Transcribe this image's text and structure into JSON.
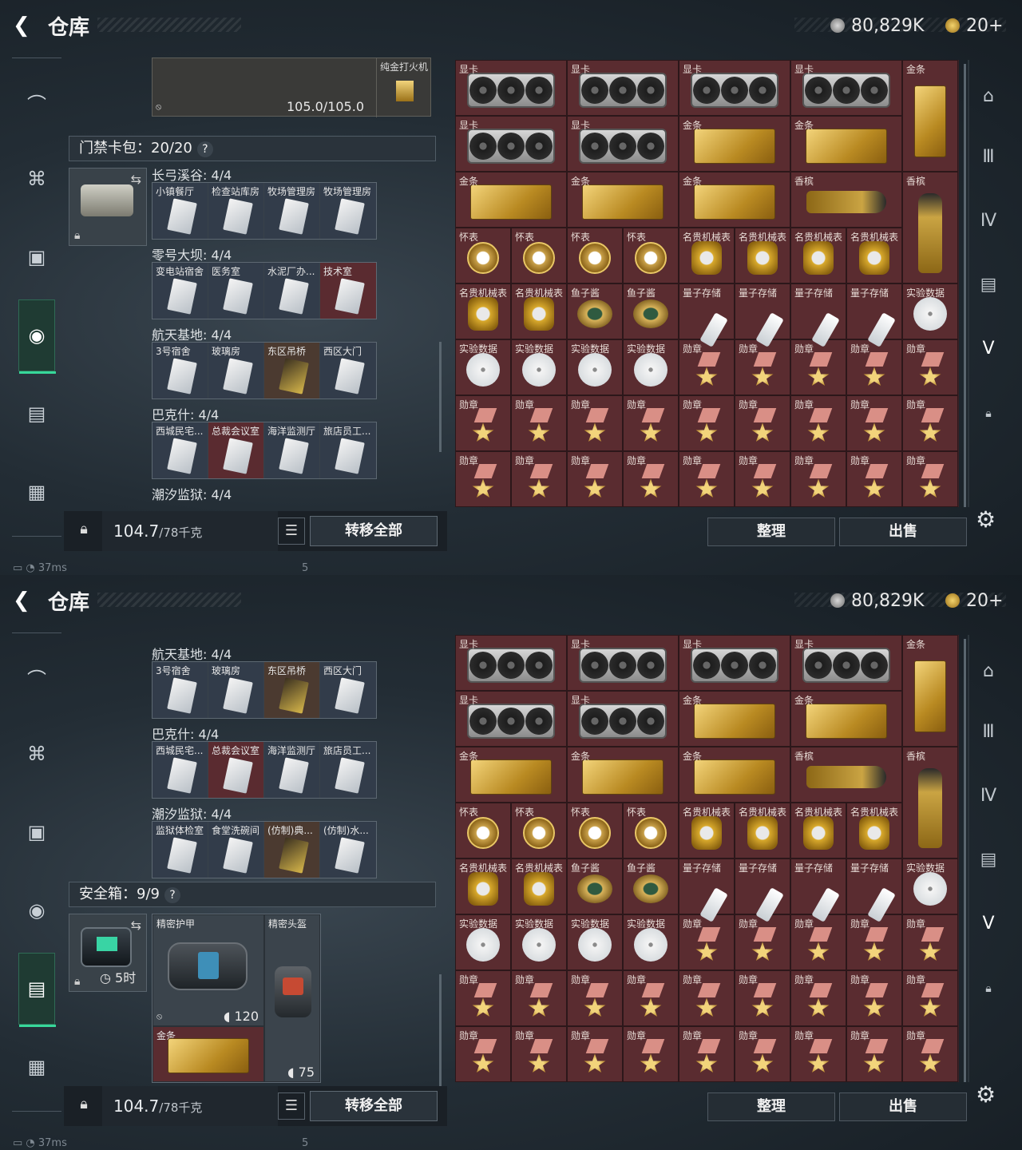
{
  "header": {
    "back_icon": "back-arrow-icon",
    "title": "仓库",
    "currency1": "80,829K",
    "currency2": "20+"
  },
  "screens": [
    {
      "top_item": {
        "durability": "105.0/105.0",
        "side_item": "纯金打火机"
      },
      "keycard_section": {
        "title": "门禁卡包：",
        "count": "20/20",
        "help": "?"
      },
      "groups": [
        {
          "title": "长弓溪谷: 4/4",
          "cards": [
            {
              "name": "小镇餐厅",
              "tone": "blue"
            },
            {
              "name": "检查站库房",
              "tone": "blue"
            },
            {
              "name": "牧场管理房",
              "tone": "blue"
            },
            {
              "name": "牧场管理房",
              "tone": "blue"
            }
          ]
        },
        {
          "title": "零号大坝: 4/4",
          "cards": [
            {
              "name": "变电站宿舍",
              "tone": "blue"
            },
            {
              "name": "医务室",
              "tone": "blue"
            },
            {
              "name": "水泥厂办...",
              "tone": "blue"
            },
            {
              "name": "技术室",
              "tone": "red"
            }
          ]
        },
        {
          "title": "航天基地: 4/4",
          "cards": [
            {
              "name": "3号宿舍",
              "tone": "blue"
            },
            {
              "name": "玻璃房",
              "tone": "blue"
            },
            {
              "name": "东区吊桥",
              "tone": "gold"
            },
            {
              "name": "西区大门",
              "tone": "blue"
            }
          ]
        },
        {
          "title": "巴克什: 4/4",
          "cards": [
            {
              "name": "西城民宅...",
              "tone": "blue"
            },
            {
              "name": "总裁会议室",
              "tone": "red"
            },
            {
              "name": "海洋监测厅",
              "tone": "blue"
            },
            {
              "name": "旅店员工...",
              "tone": "blue"
            }
          ]
        },
        {
          "title": "潮汐监狱: 4/4",
          "cards": []
        }
      ],
      "weight": {
        "value": "104.7",
        "max": "/78千克"
      },
      "transfer_all": "转移全部",
      "sort": "整理",
      "sell": "出售",
      "status": {
        "ping": "37ms",
        "num": "5"
      }
    },
    {
      "groups": [
        {
          "title": "航天基地: 4/4",
          "cards": [
            {
              "name": "3号宿舍",
              "tone": "blue"
            },
            {
              "name": "玻璃房",
              "tone": "blue"
            },
            {
              "name": "东区吊桥",
              "tone": "gold"
            },
            {
              "name": "西区大门",
              "tone": "blue"
            }
          ]
        },
        {
          "title": "巴克什: 4/4",
          "cards": [
            {
              "name": "西城民宅...",
              "tone": "blue"
            },
            {
              "name": "总裁会议室",
              "tone": "red"
            },
            {
              "name": "海洋监测厅",
              "tone": "blue"
            },
            {
              "name": "旅店员工...",
              "tone": "blue"
            }
          ]
        },
        {
          "title": "潮汐监狱: 4/4",
          "cards": [
            {
              "name": "监狱体检室",
              "tone": "blue"
            },
            {
              "name": "食堂洗碗间",
              "tone": "blue"
            },
            {
              "name": "(仿制)典...",
              "tone": "gold"
            },
            {
              "name": "(仿制)水...",
              "tone": "blue"
            }
          ]
        }
      ],
      "safe_section": {
        "title": "安全箱：",
        "count": "9/9",
        "help": "?",
        "timer": "5时"
      },
      "safe_items": {
        "armor": "精密护甲",
        "armor_dur": "120",
        "helmet": "精密头盔",
        "helmet_dur": "75",
        "gold": "金条"
      },
      "weight": {
        "value": "104.7",
        "max": "/78千克"
      },
      "transfer_all": "转移全部",
      "sort": "整理",
      "sell": "出售",
      "status": {
        "ping": "37ms",
        "num": "5"
      }
    }
  ],
  "stash_items": [
    {
      "n": "显卡",
      "t": "gpu",
      "c": 0,
      "r": 0,
      "w": 2,
      "h": 1
    },
    {
      "n": "显卡",
      "t": "gpu",
      "c": 2,
      "r": 0,
      "w": 2,
      "h": 1
    },
    {
      "n": "显卡",
      "t": "gpu",
      "c": 4,
      "r": 0,
      "w": 2,
      "h": 1
    },
    {
      "n": "显卡",
      "t": "gpu",
      "c": 6,
      "r": 0,
      "w": 2,
      "h": 1
    },
    {
      "n": "金条",
      "t": "barv",
      "c": 8,
      "r": 0,
      "w": 1,
      "h": 2
    },
    {
      "n": "显卡",
      "t": "gpu",
      "c": 0,
      "r": 1,
      "w": 2,
      "h": 1
    },
    {
      "n": "显卡",
      "t": "gpu",
      "c": 2,
      "r": 1,
      "w": 2,
      "h": 1
    },
    {
      "n": "金条",
      "t": "barh",
      "c": 4,
      "r": 1,
      "w": 2,
      "h": 1
    },
    {
      "n": "金条",
      "t": "barh",
      "c": 6,
      "r": 1,
      "w": 2,
      "h": 1
    },
    {
      "n": "金条",
      "t": "barh",
      "c": 0,
      "r": 2,
      "w": 2,
      "h": 1
    },
    {
      "n": "金条",
      "t": "barh",
      "c": 2,
      "r": 2,
      "w": 2,
      "h": 1
    },
    {
      "n": "金条",
      "t": "barh",
      "c": 4,
      "r": 2,
      "w": 2,
      "h": 1
    },
    {
      "n": "香槟",
      "t": "champh",
      "c": 6,
      "r": 2,
      "w": 2,
      "h": 1
    },
    {
      "n": "香槟",
      "t": "champv",
      "c": 8,
      "r": 2,
      "w": 1,
      "h": 2
    },
    {
      "n": "怀表",
      "t": "watch",
      "c": 0,
      "r": 3,
      "w": 1,
      "h": 1
    },
    {
      "n": "怀表",
      "t": "watch",
      "c": 1,
      "r": 3,
      "w": 1,
      "h": 1
    },
    {
      "n": "怀表",
      "t": "watch",
      "c": 2,
      "r": 3,
      "w": 1,
      "h": 1
    },
    {
      "n": "怀表",
      "t": "watch",
      "c": 3,
      "r": 3,
      "w": 1,
      "h": 1
    },
    {
      "n": "名贵机械表",
      "t": "rolex",
      "c": 4,
      "r": 3,
      "w": 1,
      "h": 1
    },
    {
      "n": "名贵机械表",
      "t": "rolex",
      "c": 5,
      "r": 3,
      "w": 1,
      "h": 1
    },
    {
      "n": "名贵机械表",
      "t": "rolex",
      "c": 6,
      "r": 3,
      "w": 1,
      "h": 1
    },
    {
      "n": "名贵机械表",
      "t": "rolex",
      "c": 7,
      "r": 3,
      "w": 1,
      "h": 1
    },
    {
      "n": "名贵机械表",
      "t": "rolex",
      "c": 0,
      "r": 4,
      "w": 1,
      "h": 1
    },
    {
      "n": "名贵机械表",
      "t": "rolex",
      "c": 1,
      "r": 4,
      "w": 1,
      "h": 1
    },
    {
      "n": "鱼子酱",
      "t": "caviar",
      "c": 2,
      "r": 4,
      "w": 1,
      "h": 1
    },
    {
      "n": "鱼子酱",
      "t": "caviar",
      "c": 3,
      "r": 4,
      "w": 1,
      "h": 1
    },
    {
      "n": "量子存储",
      "t": "usb",
      "c": 4,
      "r": 4,
      "w": 1,
      "h": 1
    },
    {
      "n": "量子存储",
      "t": "usb",
      "c": 5,
      "r": 4,
      "w": 1,
      "h": 1
    },
    {
      "n": "量子存储",
      "t": "usb",
      "c": 6,
      "r": 4,
      "w": 1,
      "h": 1
    },
    {
      "n": "量子存储",
      "t": "usb",
      "c": 7,
      "r": 4,
      "w": 1,
      "h": 1
    },
    {
      "n": "实验数据",
      "t": "disc",
      "c": 8,
      "r": 4,
      "w": 1,
      "h": 1
    },
    {
      "n": "实验数据",
      "t": "disc",
      "c": 0,
      "r": 5,
      "w": 1,
      "h": 1
    },
    {
      "n": "实验数据",
      "t": "disc",
      "c": 1,
      "r": 5,
      "w": 1,
      "h": 1
    },
    {
      "n": "实验数据",
      "t": "disc",
      "c": 2,
      "r": 5,
      "w": 1,
      "h": 1
    },
    {
      "n": "实验数据",
      "t": "disc",
      "c": 3,
      "r": 5,
      "w": 1,
      "h": 1
    },
    {
      "n": "勋章",
      "t": "medal",
      "c": 4,
      "r": 5,
      "w": 1,
      "h": 1
    },
    {
      "n": "勋章",
      "t": "medal",
      "c": 5,
      "r": 5,
      "w": 1,
      "h": 1
    },
    {
      "n": "勋章",
      "t": "medal",
      "c": 6,
      "r": 5,
      "w": 1,
      "h": 1
    },
    {
      "n": "勋章",
      "t": "medal",
      "c": 7,
      "r": 5,
      "w": 1,
      "h": 1
    },
    {
      "n": "勋章",
      "t": "medal",
      "c": 8,
      "r": 5,
      "w": 1,
      "h": 1
    },
    {
      "n": "勋章",
      "t": "medal",
      "c": 0,
      "r": 6,
      "w": 1,
      "h": 1
    },
    {
      "n": "勋章",
      "t": "medal",
      "c": 1,
      "r": 6,
      "w": 1,
      "h": 1
    },
    {
      "n": "勋章",
      "t": "medal",
      "c": 2,
      "r": 6,
      "w": 1,
      "h": 1
    },
    {
      "n": "勋章",
      "t": "medal",
      "c": 3,
      "r": 6,
      "w": 1,
      "h": 1
    },
    {
      "n": "勋章",
      "t": "medal",
      "c": 4,
      "r": 6,
      "w": 1,
      "h": 1
    },
    {
      "n": "勋章",
      "t": "medal",
      "c": 5,
      "r": 6,
      "w": 1,
      "h": 1
    },
    {
      "n": "勋章",
      "t": "medal",
      "c": 6,
      "r": 6,
      "w": 1,
      "h": 1
    },
    {
      "n": "勋章",
      "t": "medal",
      "c": 7,
      "r": 6,
      "w": 1,
      "h": 1
    },
    {
      "n": "勋章",
      "t": "medal",
      "c": 8,
      "r": 6,
      "w": 1,
      "h": 1
    },
    {
      "n": "勋章",
      "t": "medal",
      "c": 0,
      "r": 7,
      "w": 1,
      "h": 1
    },
    {
      "n": "勋章",
      "t": "medal",
      "c": 1,
      "r": 7,
      "w": 1,
      "h": 1
    },
    {
      "n": "勋章",
      "t": "medal",
      "c": 2,
      "r": 7,
      "w": 1,
      "h": 1
    },
    {
      "n": "勋章",
      "t": "medal",
      "c": 3,
      "r": 7,
      "w": 1,
      "h": 1
    },
    {
      "n": "勋章",
      "t": "medal",
      "c": 4,
      "r": 7,
      "w": 1,
      "h": 1
    },
    {
      "n": "勋章",
      "t": "medal",
      "c": 5,
      "r": 7,
      "w": 1,
      "h": 1
    },
    {
      "n": "勋章",
      "t": "medal",
      "c": 6,
      "r": 7,
      "w": 1,
      "h": 1
    },
    {
      "n": "勋章",
      "t": "medal",
      "c": 7,
      "r": 7,
      "w": 1,
      "h": 1
    },
    {
      "n": "勋章",
      "t": "medal",
      "c": 8,
      "r": 7,
      "w": 1,
      "h": 1
    }
  ],
  "icons": {
    "sidebar": [
      "pistol-icon",
      "armor-icon",
      "chest-rig-icon",
      "backpack-icon",
      "safe-case-icon",
      "briefcase-icon"
    ],
    "right": [
      "helmet-icon",
      "tier3-icon",
      "tier4-icon",
      "tier4-box-icon",
      "tier5-icon",
      "lock-icon"
    ]
  },
  "colors": {
    "accent": "#37d89a",
    "stash_bg": "#5a2c30"
  }
}
